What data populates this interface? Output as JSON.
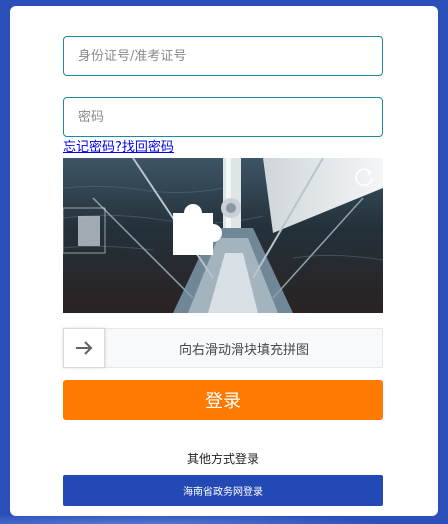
{
  "form": {
    "id_placeholder": "身份证号/准考证号",
    "password_placeholder": "密码",
    "forgot_link": "忘记密码?找回密码"
  },
  "captcha": {
    "image_alt": "sailboat mast over dark water",
    "refresh_icon": "refresh-icon",
    "slider_icon": "arrow-right-icon",
    "slider_text": "向右滑动滑块填充拼图"
  },
  "actions": {
    "login_label": "登录",
    "other_label": "其他方式登录",
    "gov_login_label": "海南省政务网登录"
  },
  "colors": {
    "background": "#2a4fb8",
    "input_border": "#1a8a9c",
    "login_button": "#ff7a00",
    "gov_button": "#2349b5",
    "link": "#0000ee"
  }
}
